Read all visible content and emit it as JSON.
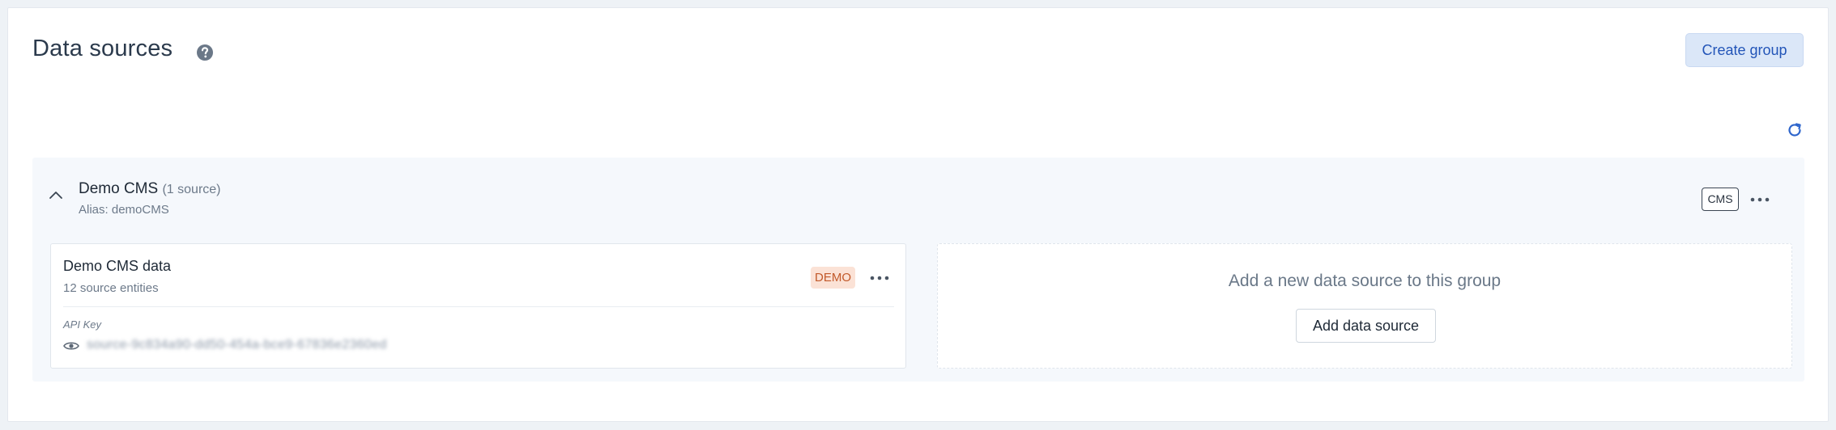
{
  "header": {
    "title": "Data sources",
    "create_group_label": "Create group"
  },
  "group": {
    "name": "Demo CMS",
    "count": "(1 source)",
    "alias": "Alias: demoCMS",
    "type_badge": "CMS",
    "sources": [
      {
        "name": "Demo CMS data",
        "entities": "12 source entities",
        "badge": "DEMO",
        "api_key_label": "API Key",
        "api_key_value": "source-9c834a90-dd50-454a-bce9-67836e2360ed"
      }
    ],
    "add_source": {
      "prompt": "Add a new data source to this group",
      "button_label": "Add data source"
    }
  },
  "colors": {
    "accent": "#2355b8",
    "demo_badge_bg": "#fbe2d6",
    "demo_badge_text": "#c2592a"
  },
  "icons": [
    "help-icon",
    "refresh-icon",
    "chevron-up-icon",
    "more-icon",
    "eye-icon"
  ]
}
